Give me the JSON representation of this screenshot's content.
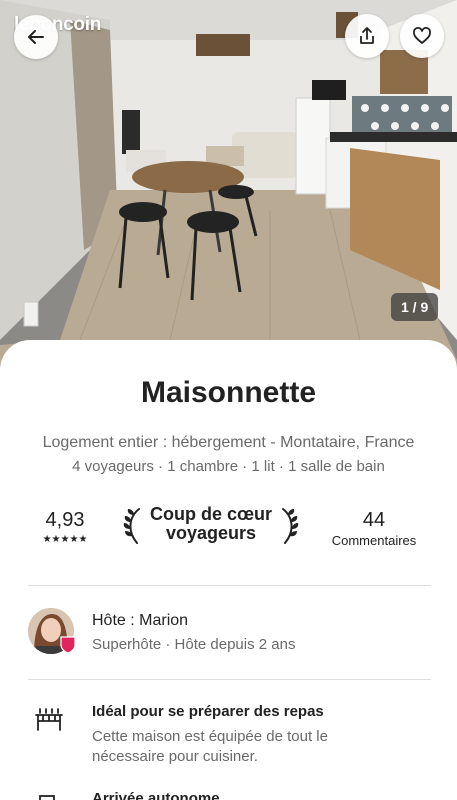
{
  "header": {
    "brand": "leboncoin",
    "photo_counter": "1 / 9",
    "back_icon": "arrow-left-icon",
    "share_icon": "share-icon",
    "favorite_icon": "heart-icon"
  },
  "listing": {
    "title": "Maisonnette",
    "subtitle": "Logement entier : hébergement - Montataire, France",
    "details": "4 voyageurs · 1 chambre · 1 lit · 1 salle de bain"
  },
  "stats": {
    "rating": "4,93",
    "stars": "★★★★★",
    "badge_line1": "Coup de cœur",
    "badge_line2": "voyageurs",
    "reviews_count": "44",
    "reviews_label": "Commentaires"
  },
  "host": {
    "name": "Hôte : Marion",
    "meta": "Superhôte · Hôte depuis 2 ans"
  },
  "features": [
    {
      "title": "Idéal pour se préparer des repas",
      "description": "Cette maison est équipée de tout le nécessaire pour cuisiner.",
      "icon": "kitchen-icon"
    },
    {
      "title": "Arrivée autonome",
      "icon": "door-icon"
    }
  ],
  "colors": {
    "primary_text": "#222222",
    "secondary_text": "#6a6a6a",
    "superhost_badge": "#e0245e"
  }
}
